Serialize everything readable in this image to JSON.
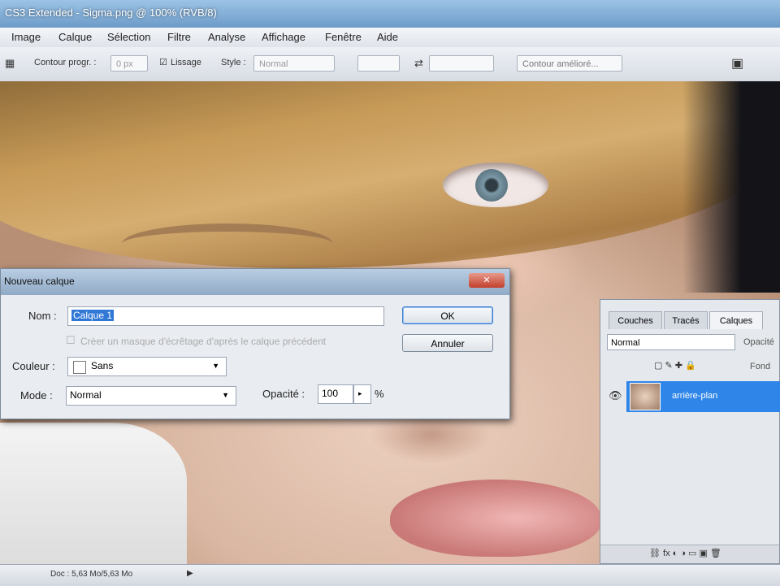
{
  "window": {
    "title": "CS3 Extended - Sigma.png @ 100% (RVB/8)"
  },
  "menu": [
    "Image",
    "Calque",
    "Sélection",
    "Filtre",
    "Analyse",
    "Affichage",
    "Fenêtre",
    "Aide"
  ],
  "options": {
    "contour_label": "Contour progr. :",
    "contour_value": "0 px",
    "lissage_label": "Lissage",
    "style_label": "Style :",
    "style_value": "Normal",
    "refine_label": "Contour amélioré..."
  },
  "dialog": {
    "title": "Nouveau calque",
    "close_glyph": "✕",
    "name_label": "Nom :",
    "name_value": "Calque 1",
    "clipping_label": "Créer un masque d'écrêtage d'après le calque précédent",
    "color_label": "Couleur :",
    "color_value": "Sans",
    "mode_label": "Mode :",
    "mode_value": "Normal",
    "opacity_label": "Opacité :",
    "opacity_value": "100",
    "opacity_unit": "%",
    "ok_label": "OK",
    "cancel_label": "Annuler"
  },
  "layers_panel": {
    "tabs": [
      "Couches",
      "Tracés",
      "Calques"
    ],
    "blend_mode": "Normal",
    "opacity_short": "Opacité",
    "fill_short": "Fond",
    "layer_name": "arrière-plan"
  },
  "status": {
    "doc": "Doc : 5,63 Mo/5,63 Mo"
  }
}
